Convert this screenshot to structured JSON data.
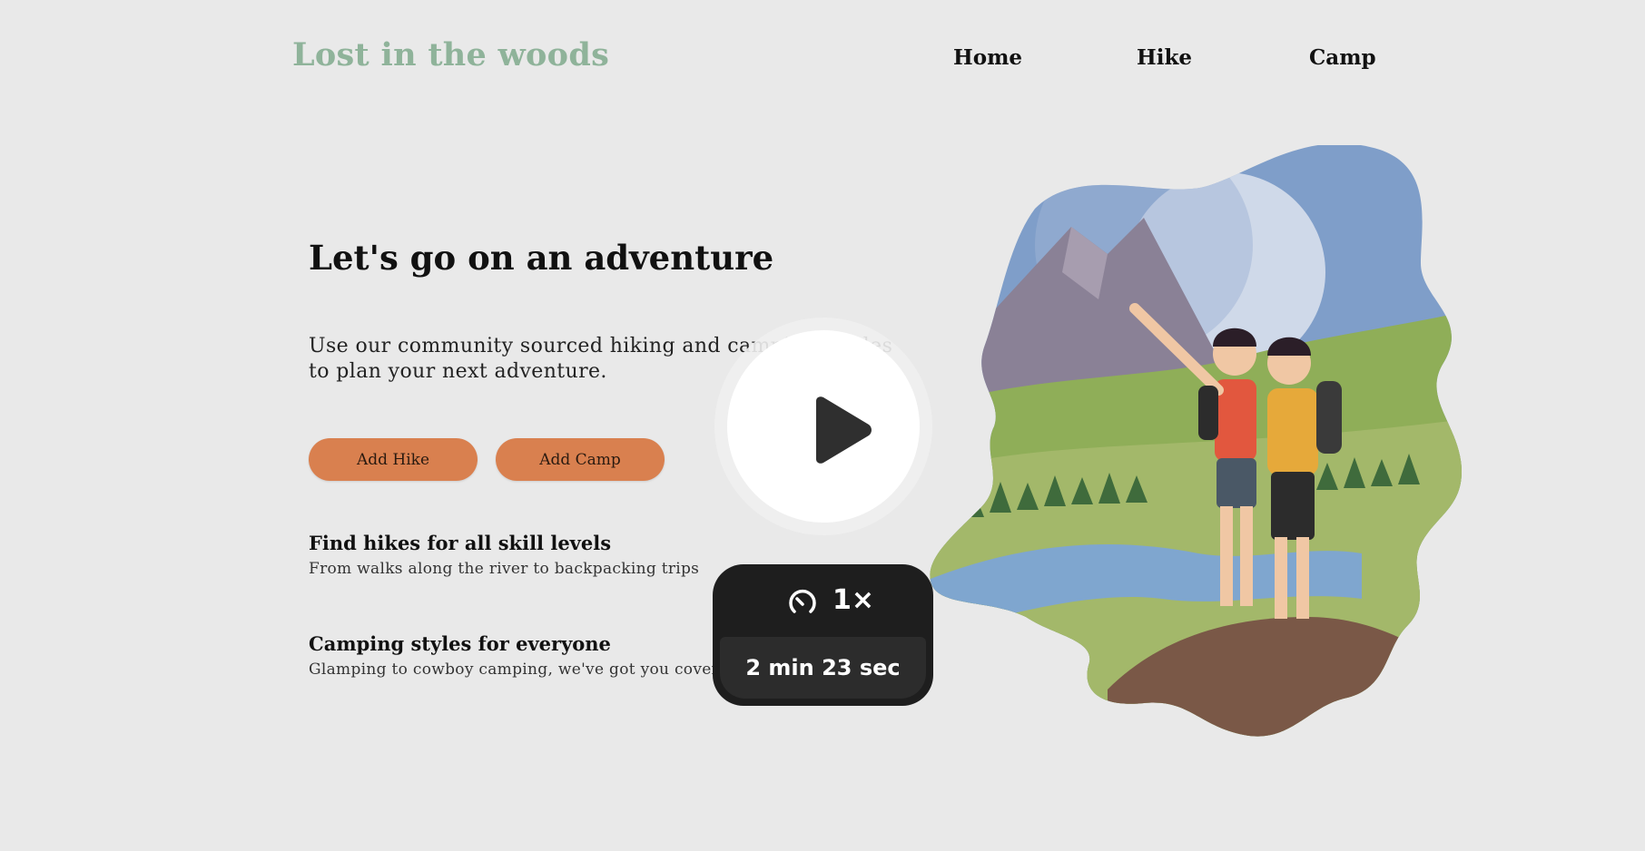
{
  "header": {
    "brand": "Lost in the woods",
    "nav": [
      {
        "label": "Home"
      },
      {
        "label": "Hike"
      },
      {
        "label": "Camp"
      }
    ]
  },
  "hero": {
    "title": "Let's go on an adventure",
    "description": "Use our community sourced hiking and camping guides to plan your next adventure.",
    "buttons": {
      "add_hike": "Add Hike",
      "add_camp": "Add Camp"
    }
  },
  "features": [
    {
      "title": "Find hikes for all skill levels",
      "subtitle": "From walks along the river to backpacking trips"
    },
    {
      "title": "Camping styles for everyone",
      "subtitle": "Glamping to cowboy camping, we've got you covered"
    }
  ],
  "video_overlay": {
    "speed": "1×",
    "duration": "2 min 23 sec",
    "icons": {
      "play": "play-icon",
      "speed": "speedometer-icon"
    }
  },
  "illustration": {
    "icon": "hikers-illustration"
  },
  "colors": {
    "background": "#e9e9e9",
    "brand": "#8fb39a",
    "button": "#d9804f",
    "overlay": "#1e1e1e"
  }
}
